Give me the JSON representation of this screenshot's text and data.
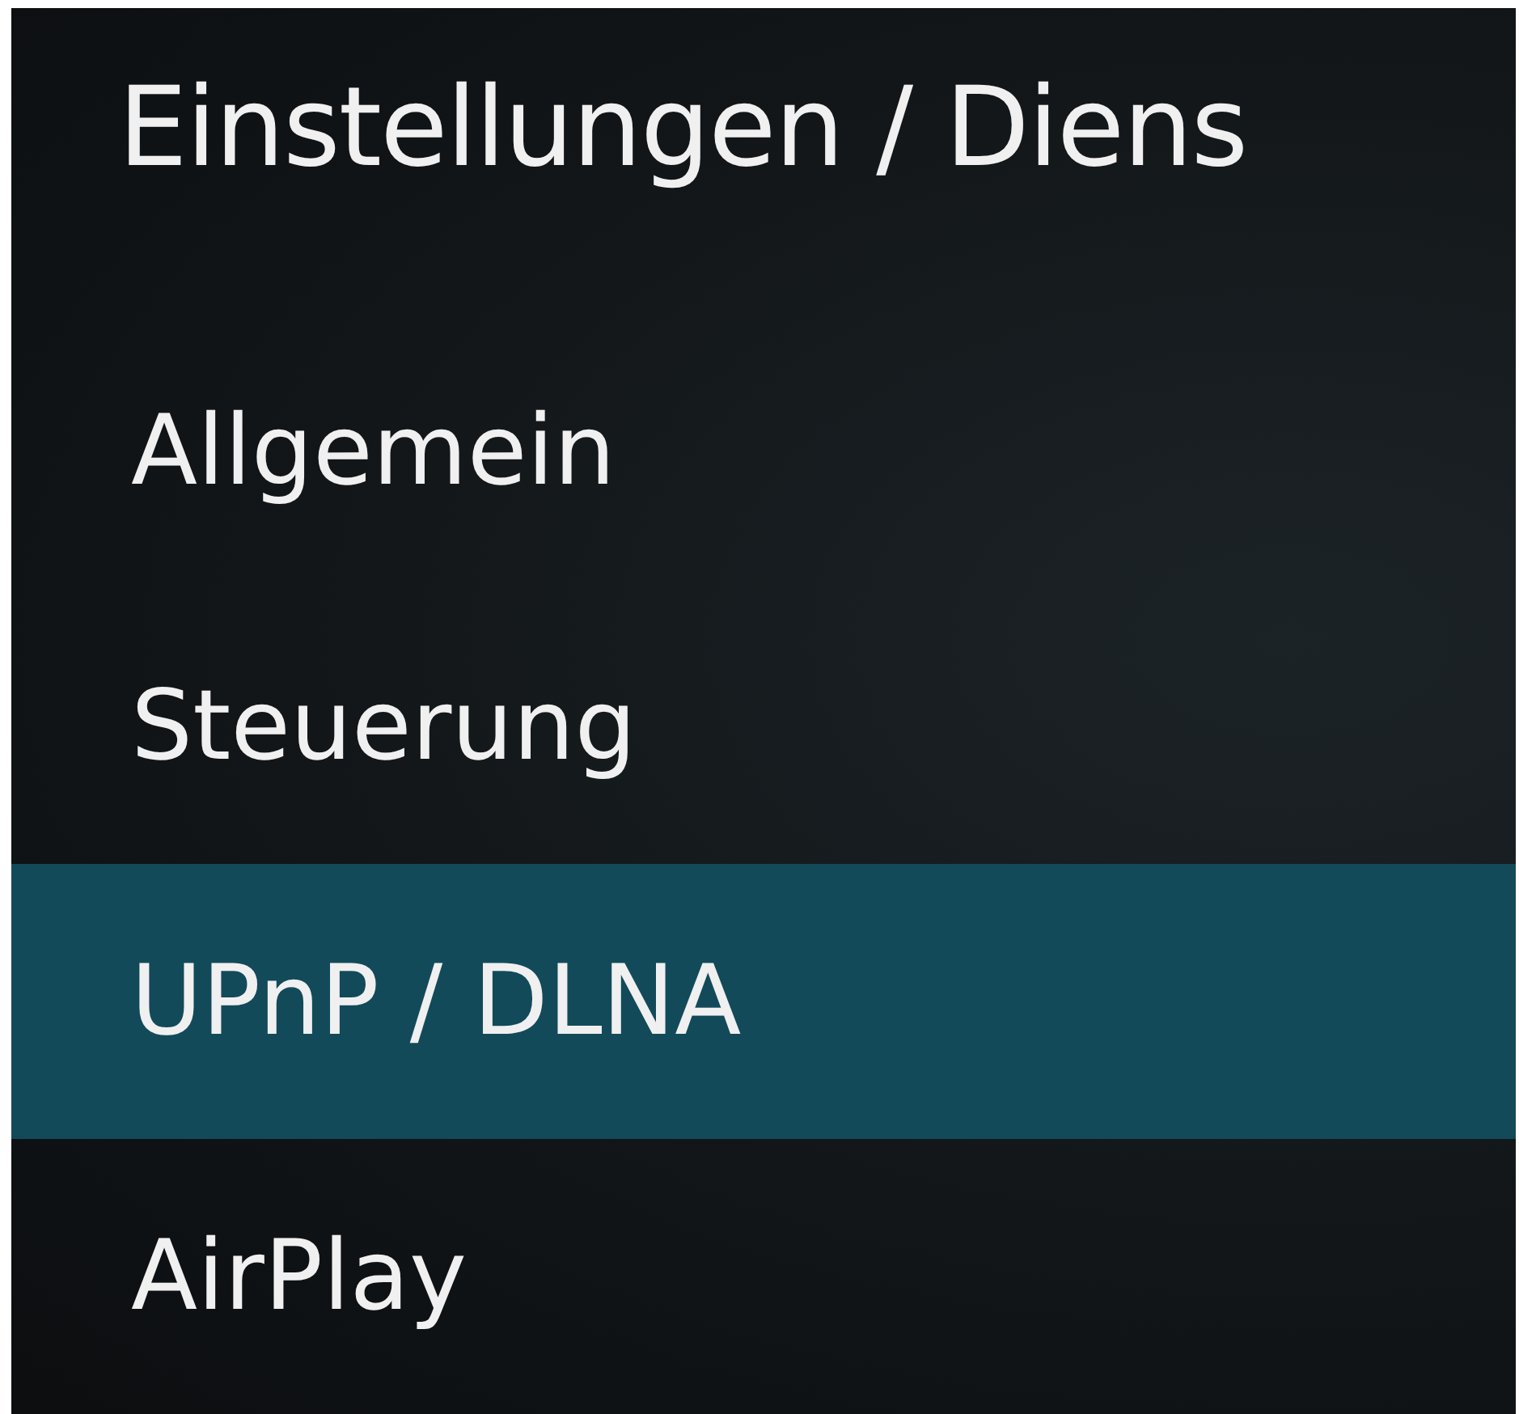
{
  "header": {
    "title": "Einstellungen / Diens"
  },
  "menu": [
    {
      "label": "Allgemein",
      "selected": false
    },
    {
      "label": "Steuerung",
      "selected": false
    },
    {
      "label": "UPnP / DLNA",
      "selected": true
    },
    {
      "label": "AirPlay",
      "selected": false
    }
  ]
}
